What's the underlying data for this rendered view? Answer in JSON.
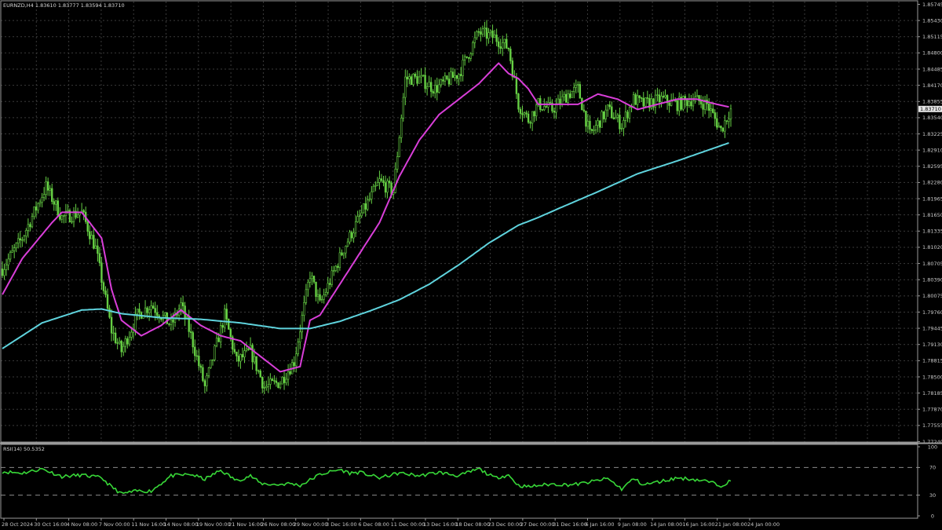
{
  "header": {
    "symbol_tf": "EURNZD,H4",
    "ohlc": "1.83610 1.83777 1.83594 1.83710"
  },
  "colors": {
    "background": "#000000",
    "candle": "#66d044",
    "ma_fast": "#d93ed9",
    "ma_slow": "#5fd3dd",
    "rsi_line": "#38d838",
    "grid": "#3a3a3a"
  },
  "current_price": "1.83710",
  "chart_data": [
    {
      "type": "candlestick",
      "title": "EURNZD,H4",
      "y_ticks": [
        "1.85745",
        "1.85430",
        "1.85115",
        "1.84800",
        "1.84485",
        "1.84170",
        "1.83855",
        "1.83540",
        "1.83225",
        "1.82910",
        "1.82595",
        "1.82280",
        "1.81965",
        "1.81650",
        "1.81335",
        "1.81020",
        "1.80705",
        "1.80390",
        "1.80075",
        "1.79760",
        "1.79445",
        "1.79130",
        "1.78815",
        "1.78500",
        "1.78185",
        "1.77870",
        "1.77555",
        "1.77240"
      ],
      "ylim": [
        1.7724,
        1.85745
      ],
      "x_ticks": [
        "28 Oct 2024",
        "30 Oct 16:00",
        "4 Nov 08:00",
        "7 Nov 00:00",
        "11 Nov 16:00",
        "14 Nov 08:00",
        "19 Nov 00:00",
        "21 Nov 16:00",
        "26 Nov 08:00",
        "29 Nov 00:00",
        "3 Dec 16:00",
        "6 Dec 08:00",
        "11 Dec 00:00",
        "13 Dec 16:00",
        "18 Dec 08:00",
        "23 Dec 00:00",
        "27 Dec 00:00",
        "31 Dec 16:00",
        "6 Jan 16:00",
        "9 Jan 08:00",
        "14 Jan 08:00",
        "16 Jan 16:00",
        "21 Jan 08:00",
        "24 Jan 00:00"
      ],
      "bar_count": 368,
      "price_path": {
        "bar_index": [
          0,
          10,
          22,
          30,
          40,
          47,
          55,
          60,
          68,
          75,
          85,
          90,
          95,
          102,
          112,
          118,
          125,
          132,
          140,
          147,
          155,
          160,
          172,
          180,
          190,
          197,
          203,
          210,
          218,
          230,
          240,
          248,
          255,
          260,
          265,
          270,
          277,
          285,
          290,
          296,
          305,
          312,
          318,
          323,
          332,
          340,
          348,
          355,
          362,
          367
        ],
        "close": [
          1.806,
          1.812,
          1.822,
          1.816,
          1.817,
          1.81,
          1.794,
          1.79,
          1.797,
          1.799,
          1.795,
          1.799,
          1.793,
          1.783,
          1.797,
          1.788,
          1.79,
          1.783,
          1.784,
          1.788,
          1.805,
          1.799,
          1.81,
          1.816,
          1.823,
          1.821,
          1.843,
          1.843,
          1.841,
          1.844,
          1.852,
          1.851,
          1.849,
          1.838,
          1.835,
          1.838,
          1.837,
          1.84,
          1.841,
          1.832,
          1.837,
          1.834,
          1.839,
          1.838,
          1.839,
          1.838,
          1.839,
          1.838,
          1.833,
          1.8371
        ]
      },
      "moving_averages": [
        {
          "name": "MA fast",
          "color": "#d93ed9",
          "points_x": [
            0,
            10,
            25,
            30,
            40,
            50,
            55,
            60,
            70,
            80,
            90,
            100,
            110,
            120,
            130,
            140,
            150,
            155,
            160,
            170,
            180,
            190,
            200,
            210,
            220,
            230,
            240,
            250,
            255,
            260,
            265,
            270,
            280,
            290,
            300,
            310,
            320,
            330,
            340,
            350,
            360,
            366
          ],
          "points_y": [
            1.801,
            1.808,
            1.815,
            1.817,
            1.817,
            1.812,
            1.802,
            1.796,
            1.793,
            1.795,
            1.798,
            1.795,
            1.793,
            1.792,
            1.789,
            1.786,
            1.787,
            1.796,
            1.797,
            1.803,
            1.809,
            1.815,
            1.824,
            1.831,
            1.836,
            1.839,
            1.842,
            1.846,
            1.844,
            1.843,
            1.841,
            1.838,
            1.838,
            1.838,
            1.84,
            1.839,
            1.837,
            1.838,
            1.839,
            1.839,
            1.838,
            1.8375
          ]
        },
        {
          "name": "MA slow",
          "color": "#5fd3dd",
          "points_x": [
            0,
            20,
            40,
            50,
            60,
            70,
            80,
            100,
            120,
            140,
            155,
            170,
            185,
            200,
            215,
            230,
            245,
            260,
            270,
            280,
            300,
            320,
            340,
            366
          ],
          "points_y": [
            1.7905,
            1.7955,
            1.798,
            1.7982,
            1.7973,
            1.7969,
            1.7965,
            1.7962,
            1.7955,
            1.7944,
            1.7944,
            1.7958,
            1.7978,
            1.8,
            1.803,
            1.8068,
            1.811,
            1.8145,
            1.816,
            1.8177,
            1.821,
            1.8245,
            1.827,
            1.8305
          ]
        }
      ]
    },
    {
      "type": "line",
      "title": "RSI(14) 50.5352",
      "series": [
        {
          "name": "RSI(14)",
          "x": [
            0,
            10,
            20,
            30,
            40,
            50,
            55,
            60,
            68,
            75,
            85,
            95,
            102,
            110,
            118,
            125,
            130,
            138,
            145,
            150,
            160,
            170,
            175,
            180,
            190,
            200,
            210,
            220,
            230,
            240,
            248,
            255,
            260,
            265,
            270,
            277,
            285,
            290,
            296,
            305,
            312,
            318,
            323,
            332,
            340,
            348,
            355,
            362,
            367
          ],
          "values": [
            64,
            62,
            68,
            57,
            59,
            55,
            42,
            32,
            36,
            36,
            58,
            60,
            53,
            66,
            51,
            58,
            47,
            45,
            47,
            44,
            60,
            67,
            62,
            63,
            55,
            62,
            58,
            63,
            58,
            68,
            55,
            59,
            44,
            42,
            44,
            46,
            45,
            46,
            49,
            54,
            39,
            54,
            45,
            50,
            55,
            53,
            50,
            44,
            50.5
          ]
        }
      ],
      "levels": [
        70,
        30
      ],
      "y_ticks": [
        "100",
        "70",
        "30",
        "0"
      ],
      "ylim": [
        0,
        100
      ]
    }
  ]
}
